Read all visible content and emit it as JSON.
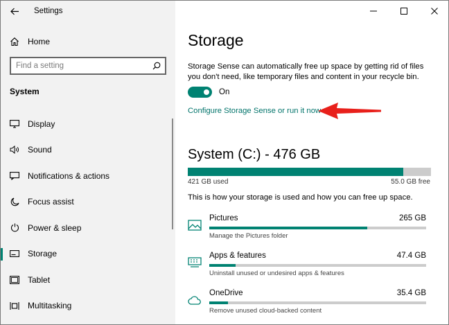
{
  "window": {
    "title": "Settings"
  },
  "sidebar": {
    "home_label": "Home",
    "search_placeholder": "Find a setting",
    "section_title": "System",
    "items": [
      {
        "label": "Display",
        "icon": "display-icon"
      },
      {
        "label": "Sound",
        "icon": "sound-icon"
      },
      {
        "label": "Notifications & actions",
        "icon": "notifications-icon"
      },
      {
        "label": "Focus assist",
        "icon": "moon-icon"
      },
      {
        "label": "Power & sleep",
        "icon": "power-icon"
      },
      {
        "label": "Storage",
        "icon": "storage-icon",
        "selected": true
      },
      {
        "label": "Tablet",
        "icon": "tablet-icon"
      },
      {
        "label": "Multitasking",
        "icon": "multitasking-icon"
      }
    ]
  },
  "main": {
    "title": "Storage",
    "description": "Storage Sense can automatically free up space by getting rid of files you don't need, like temporary files and content in your recycle bin.",
    "toggle_label": "On",
    "toggle_state": true,
    "configure_link": "Configure Storage Sense or run it now",
    "drive": {
      "title": "System (C:) - 476 GB",
      "used_label": "421 GB used",
      "free_label": "55.0 GB free",
      "used_fraction": 0.885
    },
    "storage_description": "This is how your storage is used and how you can free up space.",
    "categories": [
      {
        "name": "Pictures",
        "size": "265 GB",
        "subtitle": "Manage the Pictures folder",
        "fraction": 0.73,
        "icon": "pictures-icon"
      },
      {
        "name": "Apps & features",
        "size": "47.4 GB",
        "subtitle": "Uninstall unused or undesired apps & features",
        "fraction": 0.12,
        "icon": "apps-icon"
      },
      {
        "name": "OneDrive",
        "size": "35.4 GB",
        "subtitle": "Remove unused cloud-backed content",
        "fraction": 0.085,
        "icon": "cloud-icon"
      }
    ]
  },
  "colors": {
    "accent": "#008272",
    "annotation_arrow": "#e8201b",
    "sidebar_bg": "#f2f2f2"
  }
}
